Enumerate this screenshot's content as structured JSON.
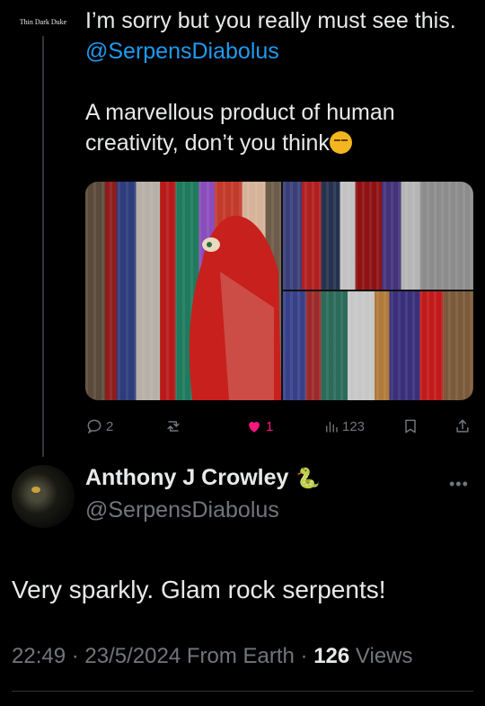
{
  "parent_tweet": {
    "avatar_label": "Thin Dark Duke",
    "text_line1": "I’m sorry but you really must see this. ",
    "mention": "@SerpensDiabolus",
    "text_para2": "A marvellous product of human creativity, don’t you think",
    "emoji": "smirking-face",
    "actions": {
      "replies": "2",
      "retweets": "",
      "likes": "1",
      "views": "123"
    },
    "colors": {
      "accent": "#1d9bf0",
      "like": "#f91880",
      "muted": "#71767b"
    }
  },
  "reply_tweet": {
    "display_name": "Anthony J Crowley",
    "badge_emoji": "🐍",
    "handle": "@SerpensDiabolus",
    "more": "•••",
    "text": "Very sparkly. Glam rock serpents!",
    "time": "22:49",
    "date": "23/5/2024",
    "location": "From Earth",
    "views_count": "126",
    "views_label": "Views"
  }
}
